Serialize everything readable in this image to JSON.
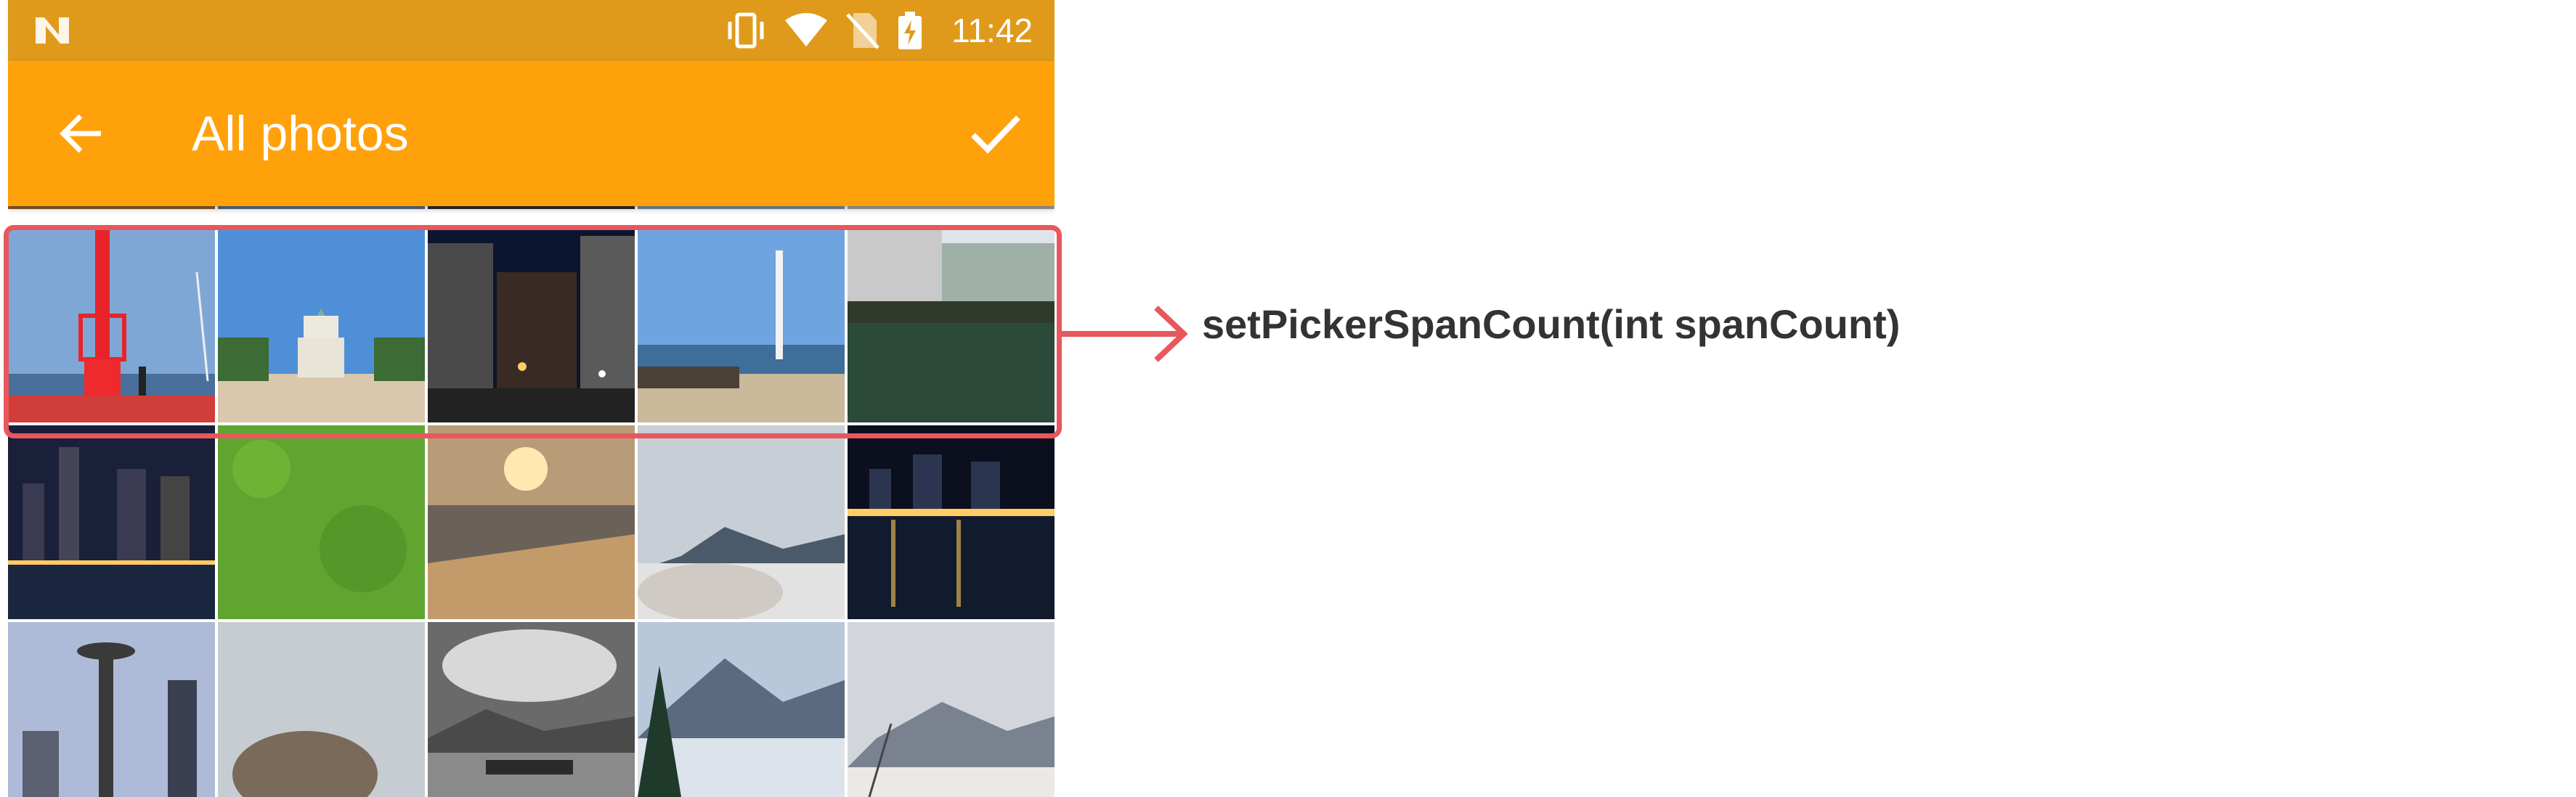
{
  "status_bar": {
    "time": "11:42",
    "icons": [
      "n-logo-icon",
      "vibrate-icon",
      "wifi-icon",
      "no-sim-icon",
      "battery-charging-icon"
    ]
  },
  "toolbar": {
    "title": "All photos",
    "back_icon": "arrow-left-icon",
    "done_icon": "check-icon"
  },
  "photos": [
    {
      "row": 0,
      "subject": "partial-top-row"
    },
    {
      "row": 1,
      "subject": [
        "red-lighthouse-pier",
        "osaka-castle",
        "city-night-buildings",
        "wind-turbine-coast",
        "canal-buildings"
      ]
    },
    {
      "row": 2,
      "subject": [
        "night-skyline",
        "grass",
        "sunset-beach",
        "snowy-mountain-rock",
        "night-harbor"
      ]
    },
    {
      "row": 3,
      "subject": [
        "space-needle",
        "rock-fog",
        "cloudy-lake-pier",
        "misty-mountains-trees",
        "snowy-hills"
      ]
    }
  ],
  "annotation": {
    "label": "setPickerSpanCount(int spanCount)",
    "color": "#e8575c"
  },
  "colors": {
    "status_bar": "#e09a1b",
    "toolbar": "#ffa10b"
  }
}
